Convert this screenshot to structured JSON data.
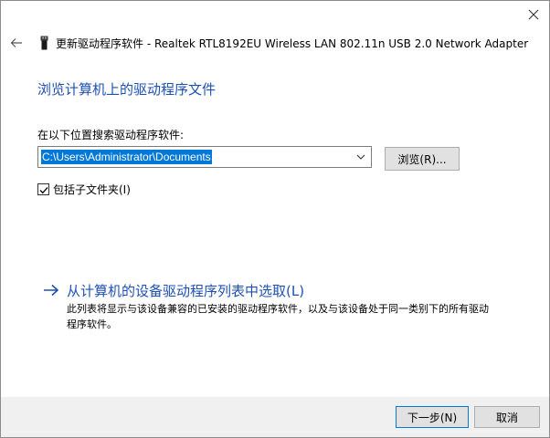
{
  "header": {
    "title": "更新驱动程序软件 - Realtek RTL8192EU Wireless LAN 802.11n USB 2.0 Network Adapter"
  },
  "section": {
    "title": "浏览计算机上的驱动程序文件"
  },
  "search": {
    "label": "在以下位置搜索驱动程序软件:",
    "path_value": "C:\\Users\\Administrator\\Documents",
    "browse_label": "浏览(R)..."
  },
  "subfolders": {
    "label": "包括子文件夹(I)",
    "checked": true
  },
  "pick": {
    "title": "从计算机的设备驱动程序列表中选取(L)",
    "description": "此列表将显示与该设备兼容的已安装的驱动程序软件，以及与该设备处于同一类别下的所有驱动程序软件。"
  },
  "footer": {
    "next_label": "下一步(N)",
    "cancel_label": "取消"
  },
  "icons": {
    "close": "close-icon",
    "back": "back-arrow-icon",
    "device": "usb-device-icon",
    "dropdown": "chevron-down-icon",
    "check": "checkmark-icon",
    "link_arrow": "arrow-right-icon"
  },
  "colors": {
    "link_blue": "#1e50b3",
    "selection_blue": "#0078d7",
    "footer_bg": "#f0f0f0"
  }
}
